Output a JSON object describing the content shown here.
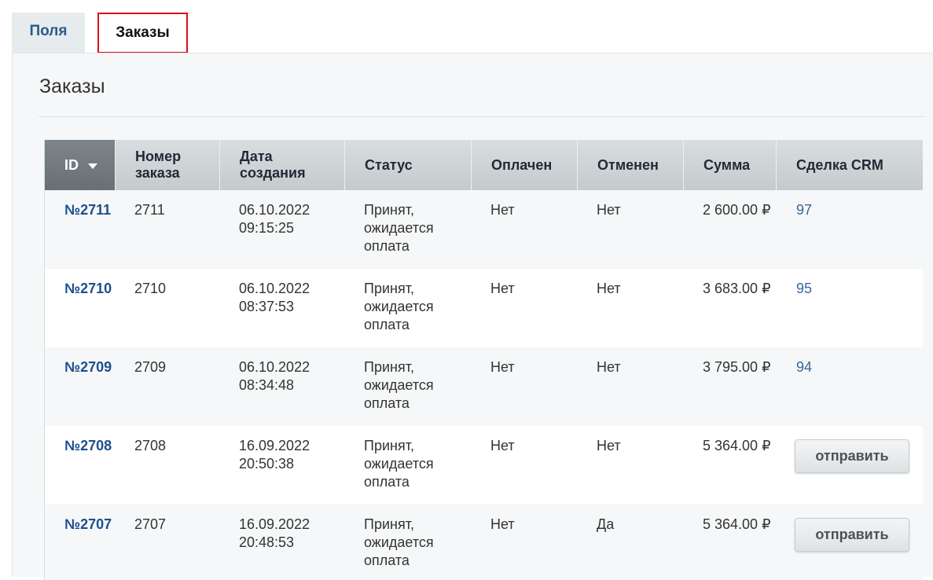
{
  "tabs": [
    {
      "label": "Поля",
      "active": false
    },
    {
      "label": "Заказы",
      "active": true
    }
  ],
  "page": {
    "title": "Заказы"
  },
  "table": {
    "columns": {
      "id": "ID",
      "number": "Номер заказа",
      "date": "Дата создания",
      "status": "Статус",
      "paid": "Оплачен",
      "canceled": "Отменен",
      "sum": "Сумма",
      "crm": "Сделка CRM"
    },
    "sorted_column": "ID",
    "sort_direction": "desc",
    "rows": [
      {
        "id": "№2711",
        "number": "2711",
        "date": "06.10.2022",
        "time": "09:15:25",
        "status": "Принят, ожидается оплата",
        "paid": "Нет",
        "canceled": "Нет",
        "sum": "2 600.00 ₽",
        "crm": "97",
        "action": ""
      },
      {
        "id": "№2710",
        "number": "2710",
        "date": "06.10.2022",
        "time": "08:37:53",
        "status": "Принят, ожидается оплата",
        "paid": "Нет",
        "canceled": "Нет",
        "sum": "3 683.00 ₽",
        "crm": "95",
        "action": ""
      },
      {
        "id": "№2709",
        "number": "2709",
        "date": "06.10.2022",
        "time": "08:34:48",
        "status": "Принят, ожидается оплата",
        "paid": "Нет",
        "canceled": "Нет",
        "sum": "3 795.00 ₽",
        "crm": "94",
        "action": ""
      },
      {
        "id": "№2708",
        "number": "2708",
        "date": "16.09.2022",
        "time": "20:50:38",
        "status": "Принят, ожидается оплата",
        "paid": "Нет",
        "canceled": "Нет",
        "sum": "5 364.00 ₽",
        "crm": "",
        "action": "отправить"
      },
      {
        "id": "№2707",
        "number": "2707",
        "date": "16.09.2022",
        "time": "20:48:53",
        "status": "Принят, ожидается оплата",
        "paid": "Нет",
        "canceled": "Да",
        "sum": "5 364.00 ₽",
        "crm": "",
        "action": "отправить"
      }
    ]
  },
  "colors": {
    "link": "#1e4f8f",
    "active_tab_border": "#d91016",
    "sorted_header": "#687076"
  }
}
